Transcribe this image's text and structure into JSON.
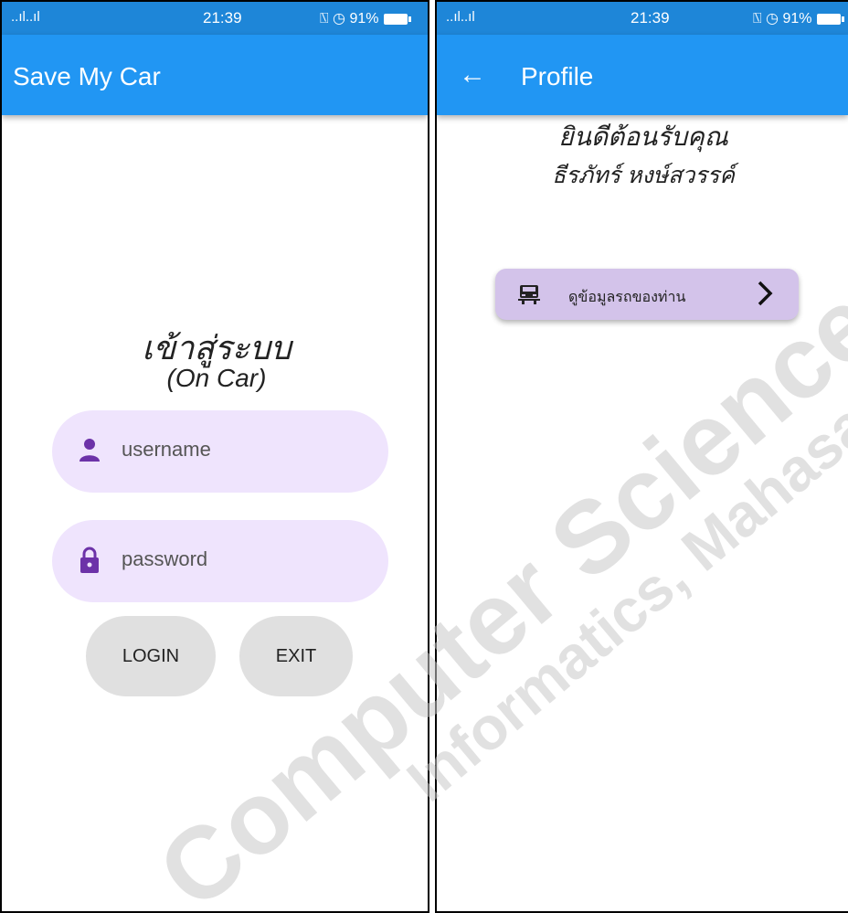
{
  "left": {
    "status": {
      "signal": "..ıl..ıl",
      "time": "21:39",
      "right": "⍂ ◷ 91%"
    },
    "appbar": {
      "title": "Save My Car"
    },
    "heading": "เข้าสู่ระบบ",
    "subheading": "(On Car)",
    "username_placeholder": "username",
    "password_placeholder": "password",
    "login_label": "LOGIN",
    "exit_label": "EXIT",
    "colors": {
      "statusbar": "#1e86d8",
      "appbar": "#2196f3",
      "field_bg": "#efe4fd",
      "icon": "#6c32a8",
      "button_bg": "#e0e0e0"
    }
  },
  "right": {
    "status": {
      "signal": "..ıl..ıl",
      "time": "21:39",
      "right": "⍂ ◷ 91%"
    },
    "appbar": {
      "title": "Profile"
    },
    "welcome_line1": "ยินดีต้อนรับคุณ",
    "welcome_line2": "ธีรภัทร์ หงษ์สวรรค์",
    "card_label": "ดูข้อมูลรถของท่าน",
    "colors": {
      "card_bg": "#d3c3ea"
    }
  },
  "watermark": {
    "line1": "Computer Science Department",
    "line2": "Informatics, Mahasarakham University"
  }
}
